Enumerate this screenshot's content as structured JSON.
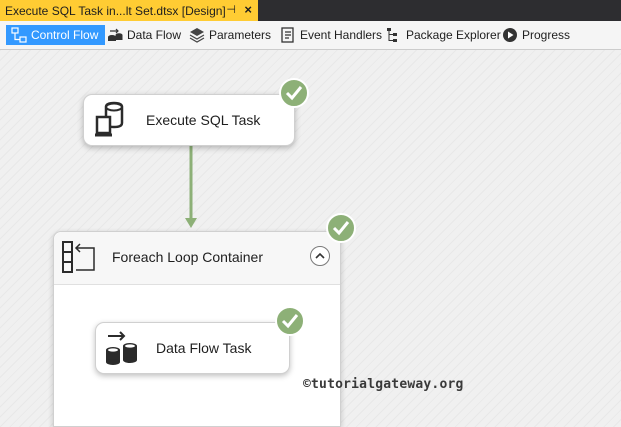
{
  "document_tab": {
    "title": "Execute SQL Task in...lt Set.dtsx [Design]",
    "pin_glyph": "⊣",
    "close_glyph": "×",
    "color": "#ffcc33"
  },
  "designer_tabs": [
    {
      "label": "Control Flow",
      "icon": "control-flow-icon",
      "active": true
    },
    {
      "label": "Data Flow",
      "icon": "data-flow-icon",
      "active": false
    },
    {
      "label": "Parameters",
      "icon": "parameters-icon",
      "active": false
    },
    {
      "label": "Event Handlers",
      "icon": "event-handlers-icon",
      "active": false
    },
    {
      "label": "Package Explorer",
      "icon": "package-explorer-icon",
      "active": false
    },
    {
      "label": "Progress",
      "icon": "progress-icon",
      "active": false
    }
  ],
  "canvas": {
    "execute_sql_task": {
      "label": "Execute SQL Task",
      "status": "success"
    },
    "foreach_loop_container": {
      "label": "Foreach Loop Container",
      "status": "success"
    },
    "data_flow_task": {
      "label": "Data Flow Task",
      "status": "success"
    },
    "precedence_color": "#8db077"
  },
  "colors": {
    "active_tab": "#3399ff",
    "success": "#8db077"
  },
  "watermark": "©tutorialgateway.org"
}
